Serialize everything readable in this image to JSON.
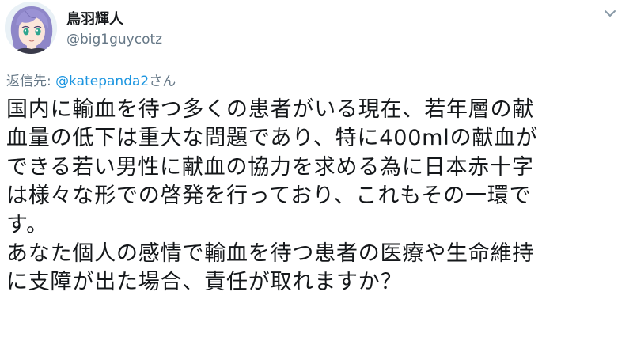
{
  "author": {
    "display_name": "鳥羽輝人",
    "handle": "@big1guycotz"
  },
  "reply": {
    "prefix": "返信先: ",
    "to_handle": "@katepanda2",
    "suffix": "さん"
  },
  "tweet": {
    "lines": [
      "国内に輸血を待つ多くの患者がいる現在、若年層の献",
      "血量の低下は重大な問題であり、特に400mlの献血が",
      "できる若い男性に献血の協力を求める為に日本赤十字",
      "は様々な形での啓発を行っており、これもその一環で",
      "す。",
      "あなた個人の感情で輸血を待つ患者の医療や生命維持",
      "に支障が出た場合、責任が取れますか？"
    ]
  },
  "icons": {
    "avatar": "anime-avatar-illustration",
    "more": "chevron-down-icon"
  },
  "colors": {
    "link": "#1b95e0",
    "secondary_text": "#657786",
    "primary_text": "#14171a"
  }
}
